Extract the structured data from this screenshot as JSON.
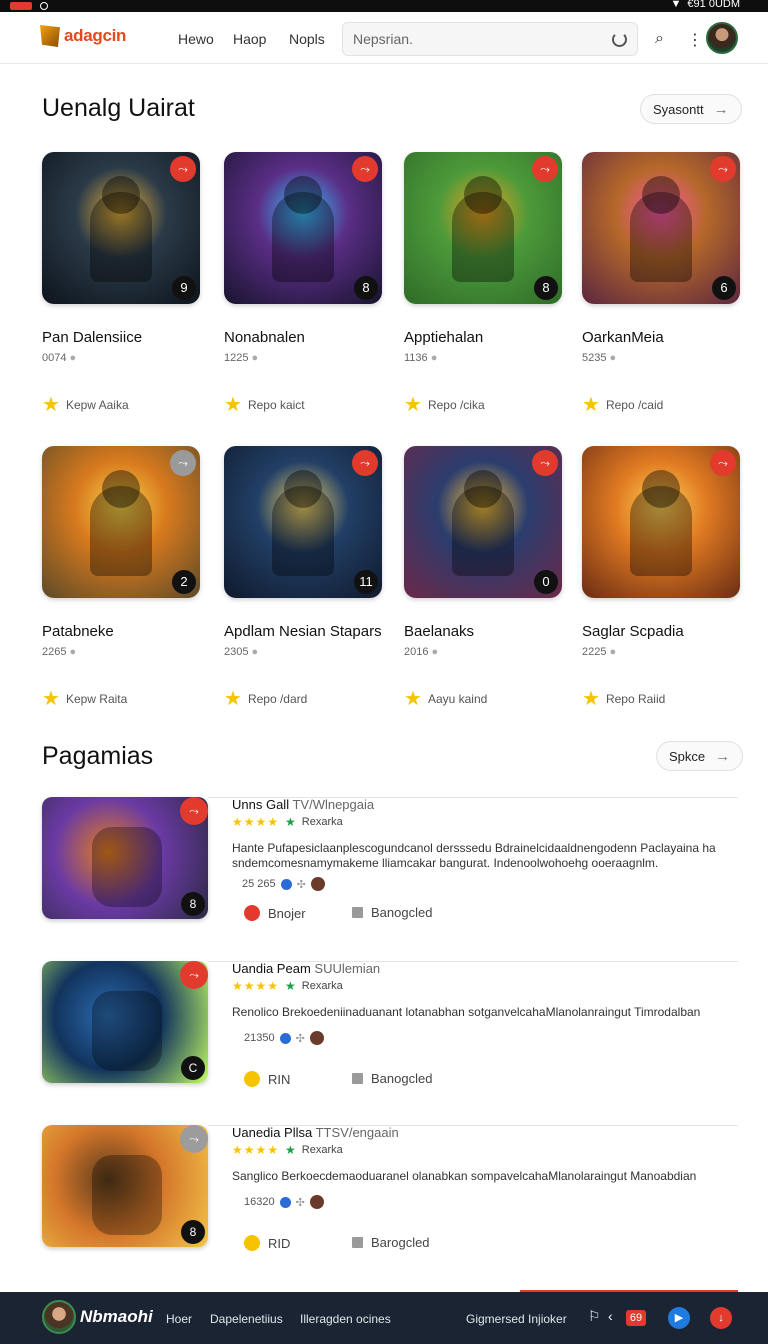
{
  "status_bar": {
    "time_text": "€91 0UDM"
  },
  "topnav": {
    "brand": "adagcin",
    "links": [
      "Hewo",
      "Haop",
      "Nopls"
    ],
    "search_placeholder": "Nepsrian."
  },
  "featured": {
    "title": "Uenalg Uairat",
    "see_all": "Syasontt",
    "tiles": [
      {
        "title": "Pan Dalensiice",
        "count": "0074",
        "rating": "Kepw Aaika",
        "badge": "9",
        "palette": [
          "#2b3a48",
          "#0d141c",
          "#e9b43c"
        ]
      },
      {
        "title": "Nonabnalen",
        "count": "1225",
        "rating": "Repo kaict",
        "badge": "8",
        "palette": [
          "#5a2e86",
          "#18142e",
          "#39c1ff"
        ]
      },
      {
        "title": "Apptiehalan",
        "count": "1136",
        "rating": "Repo /cika",
        "badge": "8",
        "palette": [
          "#4c9a3a",
          "#2f6b28",
          "#f0a320"
        ]
      },
      {
        "title": "OarkanMeia",
        "count": "5235",
        "rating": "Repo /caid",
        "badge": "6",
        "palette": [
          "#b5682a",
          "#5b2640",
          "#ff5aa8"
        ]
      },
      {
        "title": "Patabneke",
        "count": "2265",
        "rating": "Kepw Raita",
        "badge": "2",
        "palette": [
          "#d87a1e",
          "#5c4a28",
          "#f8d64a"
        ]
      },
      {
        "title": "Apdlam Nesian Stapars",
        "count": "2305",
        "rating": "Repo /dard",
        "badge": "11",
        "palette": [
          "#223f66",
          "#0f1a2c",
          "#f3d56a"
        ]
      },
      {
        "title": "Baelanaks",
        "count": "2016",
        "rating": "Aayu kaind",
        "badge": "0",
        "palette": [
          "#2b3d6e",
          "#6c2848",
          "#f6c03a"
        ]
      },
      {
        "title": "Saglar Scpadia",
        "count": "2225",
        "rating": "Repo Raiid",
        "badge": "",
        "palette": [
          "#e07a22",
          "#6a2c14",
          "#ffd256"
        ]
      }
    ]
  },
  "programs": {
    "title": "Pagamias",
    "see_all": "Spkce",
    "items": [
      {
        "title": "Unns Gall",
        "subtitle": "TV/Wlnepgaia",
        "rating_label": "Rexarka",
        "description": "Hante Pufapesiclaanplescogundcanol dersssedu Bdrainelcidaaldnengodenn Paclayaina ha sndemcomesnamymakeme lliamcakar bangurat. Indenoolwohoehg ooeraagnlm.",
        "count": "25 265",
        "action_left": "Bnojer",
        "action_right": "Banogcled",
        "badge": "8",
        "palette": [
          "#6a3aa4",
          "#e47d1e",
          "#2d2a44"
        ]
      },
      {
        "title": "Uandia Peam",
        "subtitle": "SUUlemian",
        "rating_label": "Rexarka",
        "description": "Renolico Brekoedeniinaduanant lotanabhan sotganvelcahaMlanolanraingut Timrodalban",
        "count": "21350",
        "action_left": "RIN",
        "action_right": "Banogcled",
        "badge": "C",
        "palette": [
          "#12345e",
          "#2c6ab0",
          "#c6ff64"
        ]
      },
      {
        "title": "Uanedia Pllsa",
        "subtitle": "TTSV/engaain",
        "rating_label": "Rexarka",
        "description": "Sanglico Berkoecdemaoduaranel olanabkan sompavelcahaMlanolaraingut Manoabdian",
        "count": "16320",
        "action_left": "RID",
        "action_right": "Barogcled",
        "badge": "8",
        "palette": [
          "#d4762a",
          "#5b3c1c",
          "#f3c54a"
        ]
      }
    ]
  },
  "bottombar": {
    "brand": "Nbmaohi",
    "links": [
      "Hoer",
      "Dapelenetiius",
      "Illeragden ocines"
    ],
    "right_text": "Gigmersed Injioker",
    "badge": "69"
  }
}
